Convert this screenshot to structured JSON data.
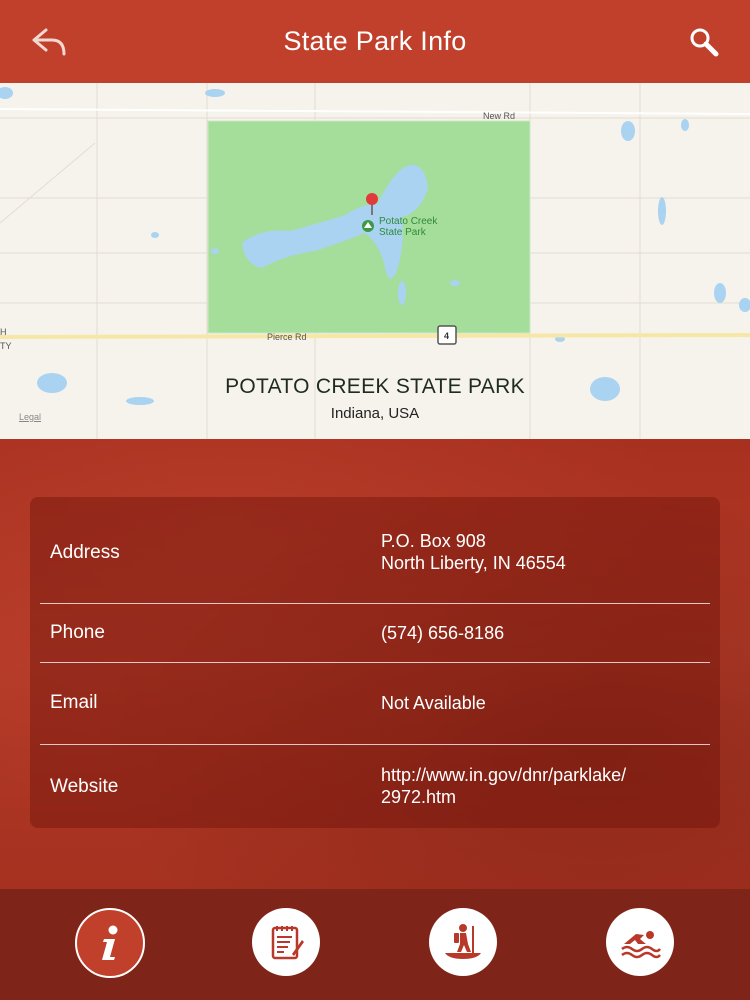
{
  "header": {
    "title": "State Park Info",
    "back_icon": "back-arrow-icon",
    "search_icon": "search-icon"
  },
  "map": {
    "road_labels": {
      "new_rd": "New Rd",
      "pierce_rd": "Pierce Rd",
      "route": "4"
    },
    "park_label": [
      "Potato Creek",
      "State Park"
    ],
    "legal": "Legal",
    "edge_labels": [
      "H",
      "TY"
    ]
  },
  "park": {
    "name": "POTATO CREEK STATE PARK",
    "location": "Indiana, USA"
  },
  "info": {
    "address": {
      "label": "Address",
      "value_line1": "P.O. Box 908",
      "value_line2": "North Liberty, IN 46554"
    },
    "phone": {
      "label": "Phone",
      "value": "(574) 656-8186"
    },
    "email": {
      "label": "Email",
      "value": "Not Available"
    },
    "website": {
      "label": "Website",
      "value_line1": "http://www.in.gov/dnr/parklake/",
      "value_line2": "2972.htm"
    }
  },
  "tabs": [
    {
      "name": "info",
      "icon": "info-icon",
      "active": true
    },
    {
      "name": "notes",
      "icon": "notepad-icon",
      "active": false
    },
    {
      "name": "paddling",
      "icon": "canoe-hiker-icon",
      "active": false
    },
    {
      "name": "swimming",
      "icon": "swimmer-icon",
      "active": false
    }
  ],
  "colors": {
    "header": "#c0402b",
    "content": "#a8301f",
    "tabbar": "#7f2418",
    "park_green": "#a5dd9b",
    "water": "#a9d3f1"
  }
}
